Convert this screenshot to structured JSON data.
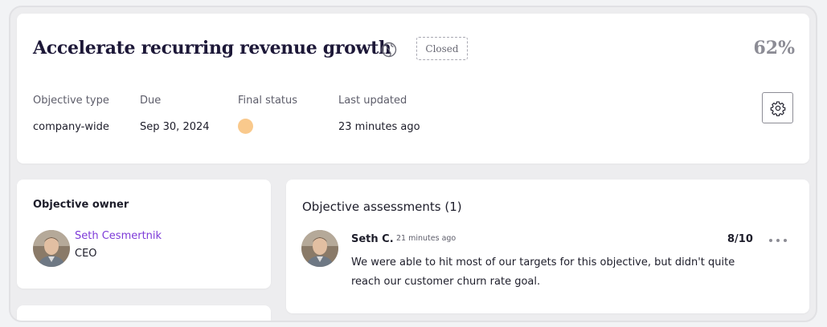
{
  "objective": {
    "title": "Accelerate recurring revenue growth",
    "scope_icon": "globe-icon",
    "status_badge": "Closed",
    "progress_percent_label": "62%",
    "progress_percent": 62
  },
  "meta": {
    "objective_type_label": "Objective type",
    "objective_type_value": "company-wide",
    "due_label": "Due",
    "due_value": "Sep 30, 2024",
    "final_status_label": "Final status",
    "final_status_color": "#f9c98c",
    "last_updated_label": "Last updated",
    "last_updated_value": "23 minutes ago"
  },
  "settings": {
    "icon": "gear-icon"
  },
  "owner": {
    "heading": "Objective owner",
    "name": "Seth Cesmertnik",
    "role": "CEO"
  },
  "assessments": {
    "heading": "Objective assessments (1)",
    "items": [
      {
        "author": "Seth C.",
        "time": "21 minutes ago",
        "score": "8/10",
        "text": "We were able to hit most of our targets for this objective, but didn't quite reach our customer churn rate goal."
      }
    ]
  },
  "colors": {
    "accent_link": "#7d3ad8",
    "title": "#1d1838",
    "muted": "#8c8c95"
  }
}
